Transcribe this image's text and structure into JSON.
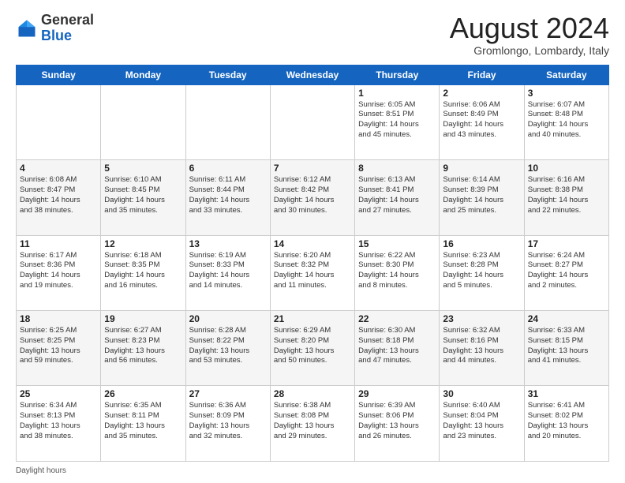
{
  "logo": {
    "general": "General",
    "blue": "Blue"
  },
  "header": {
    "month": "August 2024",
    "location": "Gromlongo, Lombardy, Italy"
  },
  "days_of_week": [
    "Sunday",
    "Monday",
    "Tuesday",
    "Wednesday",
    "Thursday",
    "Friday",
    "Saturday"
  ],
  "weeks": [
    [
      {
        "day": "",
        "info": ""
      },
      {
        "day": "",
        "info": ""
      },
      {
        "day": "",
        "info": ""
      },
      {
        "day": "",
        "info": ""
      },
      {
        "day": "1",
        "info": "Sunrise: 6:05 AM\nSunset: 8:51 PM\nDaylight: 14 hours\nand 45 minutes."
      },
      {
        "day": "2",
        "info": "Sunrise: 6:06 AM\nSunset: 8:49 PM\nDaylight: 14 hours\nand 43 minutes."
      },
      {
        "day": "3",
        "info": "Sunrise: 6:07 AM\nSunset: 8:48 PM\nDaylight: 14 hours\nand 40 minutes."
      }
    ],
    [
      {
        "day": "4",
        "info": "Sunrise: 6:08 AM\nSunset: 8:47 PM\nDaylight: 14 hours\nand 38 minutes."
      },
      {
        "day": "5",
        "info": "Sunrise: 6:10 AM\nSunset: 8:45 PM\nDaylight: 14 hours\nand 35 minutes."
      },
      {
        "day": "6",
        "info": "Sunrise: 6:11 AM\nSunset: 8:44 PM\nDaylight: 14 hours\nand 33 minutes."
      },
      {
        "day": "7",
        "info": "Sunrise: 6:12 AM\nSunset: 8:42 PM\nDaylight: 14 hours\nand 30 minutes."
      },
      {
        "day": "8",
        "info": "Sunrise: 6:13 AM\nSunset: 8:41 PM\nDaylight: 14 hours\nand 27 minutes."
      },
      {
        "day": "9",
        "info": "Sunrise: 6:14 AM\nSunset: 8:39 PM\nDaylight: 14 hours\nand 25 minutes."
      },
      {
        "day": "10",
        "info": "Sunrise: 6:16 AM\nSunset: 8:38 PM\nDaylight: 14 hours\nand 22 minutes."
      }
    ],
    [
      {
        "day": "11",
        "info": "Sunrise: 6:17 AM\nSunset: 8:36 PM\nDaylight: 14 hours\nand 19 minutes."
      },
      {
        "day": "12",
        "info": "Sunrise: 6:18 AM\nSunset: 8:35 PM\nDaylight: 14 hours\nand 16 minutes."
      },
      {
        "day": "13",
        "info": "Sunrise: 6:19 AM\nSunset: 8:33 PM\nDaylight: 14 hours\nand 14 minutes."
      },
      {
        "day": "14",
        "info": "Sunrise: 6:20 AM\nSunset: 8:32 PM\nDaylight: 14 hours\nand 11 minutes."
      },
      {
        "day": "15",
        "info": "Sunrise: 6:22 AM\nSunset: 8:30 PM\nDaylight: 14 hours\nand 8 minutes."
      },
      {
        "day": "16",
        "info": "Sunrise: 6:23 AM\nSunset: 8:28 PM\nDaylight: 14 hours\nand 5 minutes."
      },
      {
        "day": "17",
        "info": "Sunrise: 6:24 AM\nSunset: 8:27 PM\nDaylight: 14 hours\nand 2 minutes."
      }
    ],
    [
      {
        "day": "18",
        "info": "Sunrise: 6:25 AM\nSunset: 8:25 PM\nDaylight: 13 hours\nand 59 minutes."
      },
      {
        "day": "19",
        "info": "Sunrise: 6:27 AM\nSunset: 8:23 PM\nDaylight: 13 hours\nand 56 minutes."
      },
      {
        "day": "20",
        "info": "Sunrise: 6:28 AM\nSunset: 8:22 PM\nDaylight: 13 hours\nand 53 minutes."
      },
      {
        "day": "21",
        "info": "Sunrise: 6:29 AM\nSunset: 8:20 PM\nDaylight: 13 hours\nand 50 minutes."
      },
      {
        "day": "22",
        "info": "Sunrise: 6:30 AM\nSunset: 8:18 PM\nDaylight: 13 hours\nand 47 minutes."
      },
      {
        "day": "23",
        "info": "Sunrise: 6:32 AM\nSunset: 8:16 PM\nDaylight: 13 hours\nand 44 minutes."
      },
      {
        "day": "24",
        "info": "Sunrise: 6:33 AM\nSunset: 8:15 PM\nDaylight: 13 hours\nand 41 minutes."
      }
    ],
    [
      {
        "day": "25",
        "info": "Sunrise: 6:34 AM\nSunset: 8:13 PM\nDaylight: 13 hours\nand 38 minutes."
      },
      {
        "day": "26",
        "info": "Sunrise: 6:35 AM\nSunset: 8:11 PM\nDaylight: 13 hours\nand 35 minutes."
      },
      {
        "day": "27",
        "info": "Sunrise: 6:36 AM\nSunset: 8:09 PM\nDaylight: 13 hours\nand 32 minutes."
      },
      {
        "day": "28",
        "info": "Sunrise: 6:38 AM\nSunset: 8:08 PM\nDaylight: 13 hours\nand 29 minutes."
      },
      {
        "day": "29",
        "info": "Sunrise: 6:39 AM\nSunset: 8:06 PM\nDaylight: 13 hours\nand 26 minutes."
      },
      {
        "day": "30",
        "info": "Sunrise: 6:40 AM\nSunset: 8:04 PM\nDaylight: 13 hours\nand 23 minutes."
      },
      {
        "day": "31",
        "info": "Sunrise: 6:41 AM\nSunset: 8:02 PM\nDaylight: 13 hours\nand 20 minutes."
      }
    ]
  ],
  "footer": {
    "daylight_label": "Daylight hours"
  }
}
